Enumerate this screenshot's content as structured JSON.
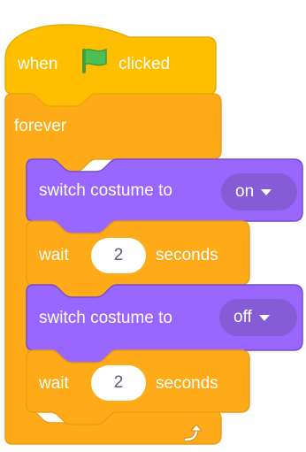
{
  "colors": {
    "events": "#ffbf00",
    "events_border": "#e6ac00",
    "control": "#ffab19",
    "control_border": "#ec9c13",
    "looks": "#9966ff",
    "looks_border": "#774dcb",
    "looks_field": "#855cd6",
    "flag": "#4cbf56"
  },
  "hat_block": {
    "when_label": "when",
    "flag_icon": "green-flag-icon",
    "clicked_label": "clicked"
  },
  "forever_block": {
    "label": "forever",
    "loop_icon": "loop-arrow-icon"
  },
  "stack": [
    {
      "type": "looks",
      "label": "switch costume to",
      "dropdown": "on"
    },
    {
      "type": "control",
      "label": "wait",
      "value": "2",
      "suffix": "seconds"
    },
    {
      "type": "looks",
      "label": "switch costume to",
      "dropdown": "off"
    },
    {
      "type": "control",
      "label": "wait",
      "value": "2",
      "suffix": "seconds"
    }
  ]
}
